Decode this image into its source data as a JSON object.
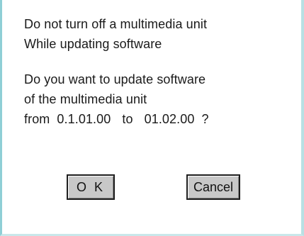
{
  "dialog": {
    "warning_lines": [
      "Do not turn off a multimedia unit",
      "While updating software"
    ],
    "question_lines": [
      "Do you want to update software",
      "of the multimedia unit"
    ],
    "update_line": {
      "from_label": "from",
      "from_version": "0.1.01.00",
      "to_label": "to",
      "to_version": "01.02.00",
      "question_mark": "?"
    }
  },
  "buttons": {
    "ok_label": "O K",
    "cancel_label": "Cancel"
  }
}
